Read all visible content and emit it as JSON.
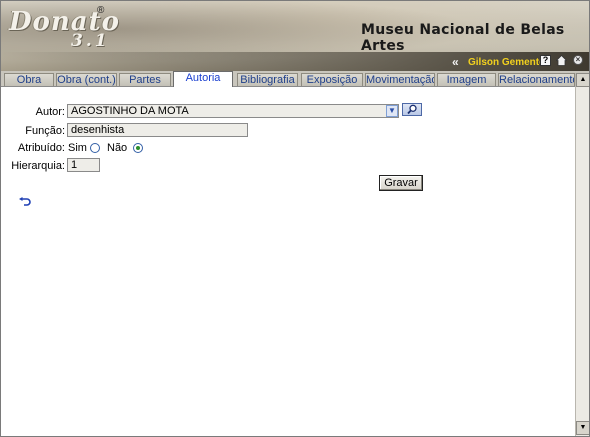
{
  "header": {
    "logo_word": "Donato",
    "logo_number": "3.1",
    "logo_reg": "®",
    "museum_name": "Museu Nacional de Belas Artes",
    "nav_chevron": "«",
    "user_name": "Gilson Gemente",
    "help_label": "?"
  },
  "tabs": [
    {
      "label": "Obra"
    },
    {
      "label": "Obra (cont.)"
    },
    {
      "label": "Partes"
    },
    {
      "label": "Autoria",
      "active": true
    },
    {
      "label": "Bibliografia"
    },
    {
      "label": "Exposição"
    },
    {
      "label": "Movimentação"
    },
    {
      "label": "Imagem"
    },
    {
      "label": "Relacionamento"
    }
  ],
  "form": {
    "autor_label": "Autor:",
    "autor_value": "AGOSTINHO DA MOTA",
    "funcao_label": "Função:",
    "funcao_value": "desenhista",
    "atribuido_label": "Atribuído:",
    "sim_label": "Sim",
    "nao_label": "Não",
    "atribuido_selected": "Não",
    "hierarquia_label": "Hierarquia:",
    "hierarquia_value": "1",
    "save_label": "Gravar"
  },
  "icons": {
    "undo": "undo-arrow-icon",
    "search": "magnifier-icon",
    "home": "home-icon",
    "close": "close-icon",
    "help": "help-icon"
  },
  "colors": {
    "active_tab_text": "#1a3fd0",
    "tab_text": "#1f3f8a",
    "user_name": "#f2d11e",
    "radio_selected": "#2c8f2c"
  }
}
